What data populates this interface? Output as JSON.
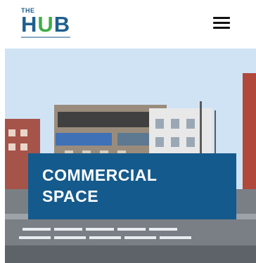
{
  "header": {
    "logo": {
      "small_text": "THE",
      "main_text_h": "H",
      "main_text_u": "U",
      "main_text_b": "B"
    },
    "menu_icon": "hamburger-menu-icon"
  },
  "hero": {
    "title": "COMMERCIAL\nSPACE"
  },
  "colors": {
    "brand_blue": "#1f5f8e",
    "brand_green": "#3fae49",
    "caption_background": "#155a8c"
  }
}
